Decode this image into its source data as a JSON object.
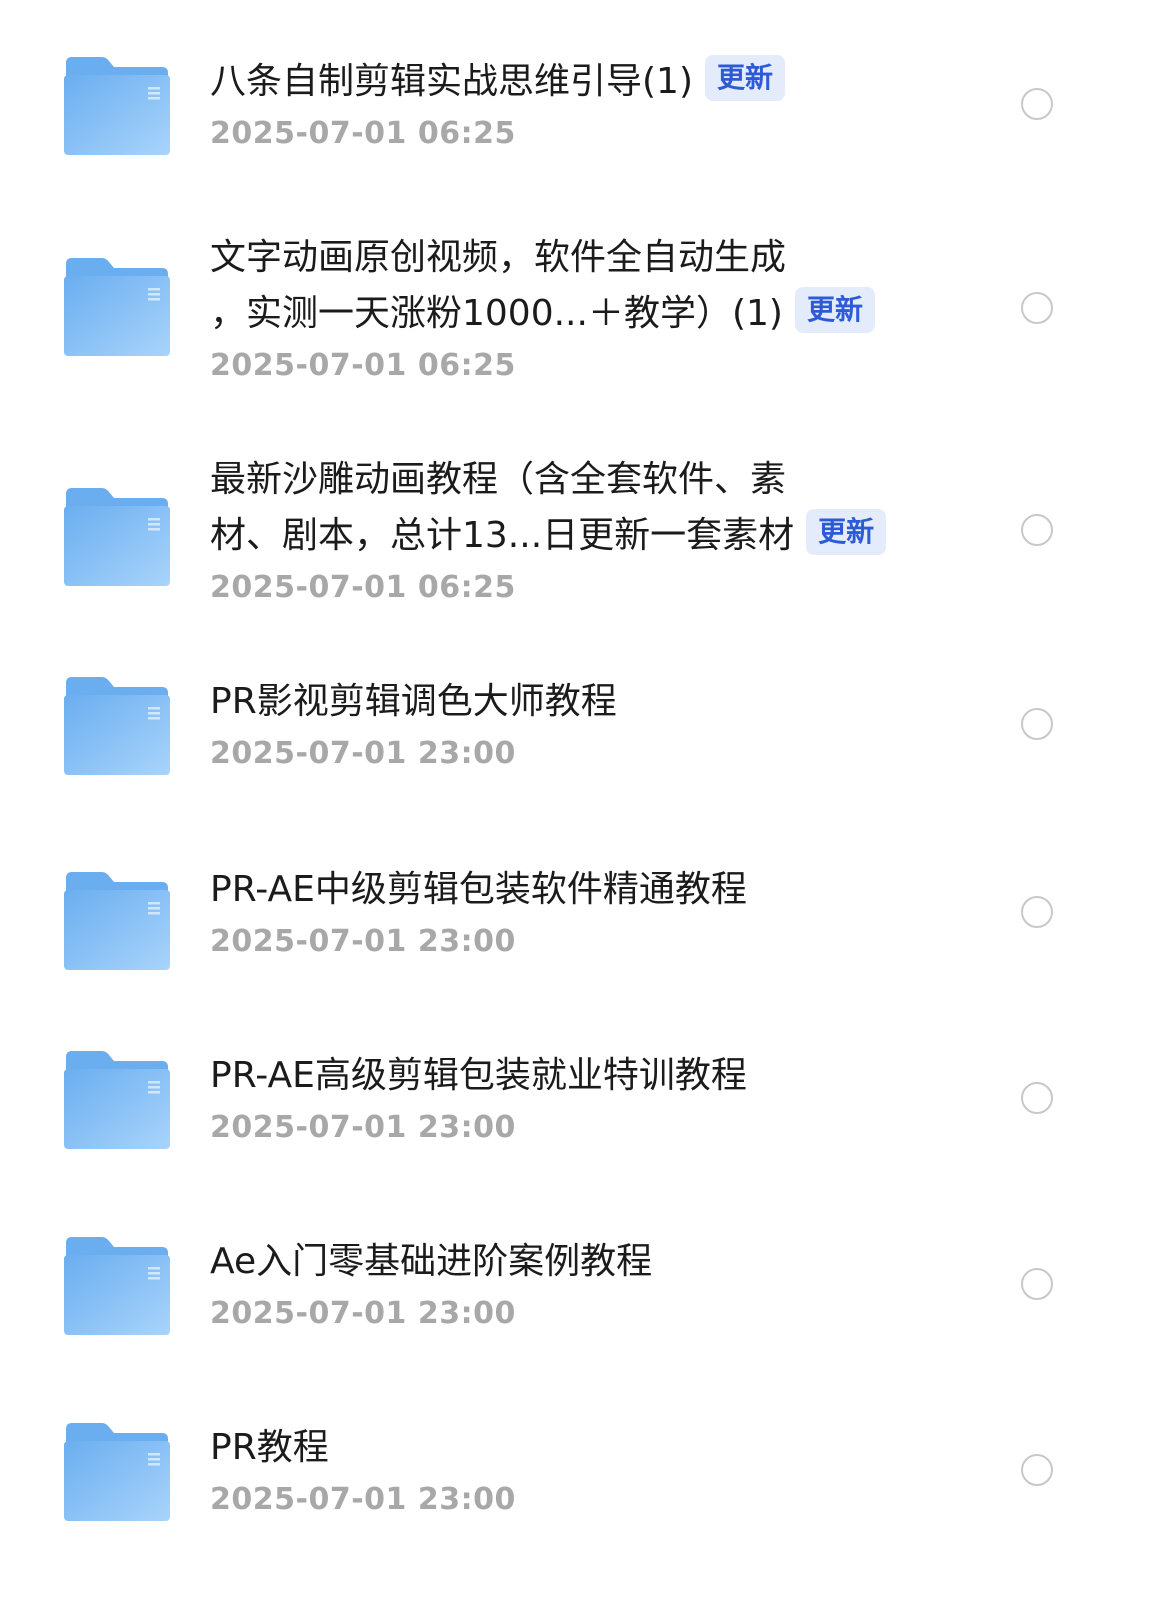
{
  "files": [
    {
      "name_lines": [
        "八条自制剪辑实战思维引导(1)"
      ],
      "badge": "更新",
      "date": "2025-07-01 06:25"
    },
    {
      "name_lines": [
        "文字动画原创视频，软件全自动生成",
        "，实测一天涨粉1000...＋教学）(1)"
      ],
      "badge": "更新",
      "date": "2025-07-01 06:25"
    },
    {
      "name_lines": [
        "最新沙雕动画教程（含全套软件、素",
        "材、剧本，总计13...日更新一套素材"
      ],
      "badge": "更新",
      "date": "2025-07-01 06:25"
    },
    {
      "name_lines": [
        "PR影视剪辑调色大师教程"
      ],
      "badge": null,
      "date": "2025-07-01 23:00"
    },
    {
      "name_lines": [
        "PR-AE中级剪辑包装软件精通教程"
      ],
      "badge": null,
      "date": "2025-07-01 23:00"
    },
    {
      "name_lines": [
        "PR-AE高级剪辑包装就业特训教程"
      ],
      "badge": null,
      "date": "2025-07-01 23:00"
    },
    {
      "name_lines": [
        "Ae入门零基础进阶案例教程"
      ],
      "badge": null,
      "date": "2025-07-01 23:00"
    },
    {
      "name_lines": [
        "PR教程"
      ],
      "badge": null,
      "date": "2025-07-01 23:00"
    }
  ],
  "icons": {
    "folder": "folder-icon",
    "select": "radio-circle-icon"
  },
  "colors": {
    "folder_light": "#a9d4fb",
    "folder_dark": "#6aaef0",
    "badge_text": "#2d5bd8",
    "badge_bg": "#e4ebfb",
    "title_text": "#1b1b1b",
    "date_text": "#a8a8a8",
    "radio_border": "#c8c8c8"
  }
}
